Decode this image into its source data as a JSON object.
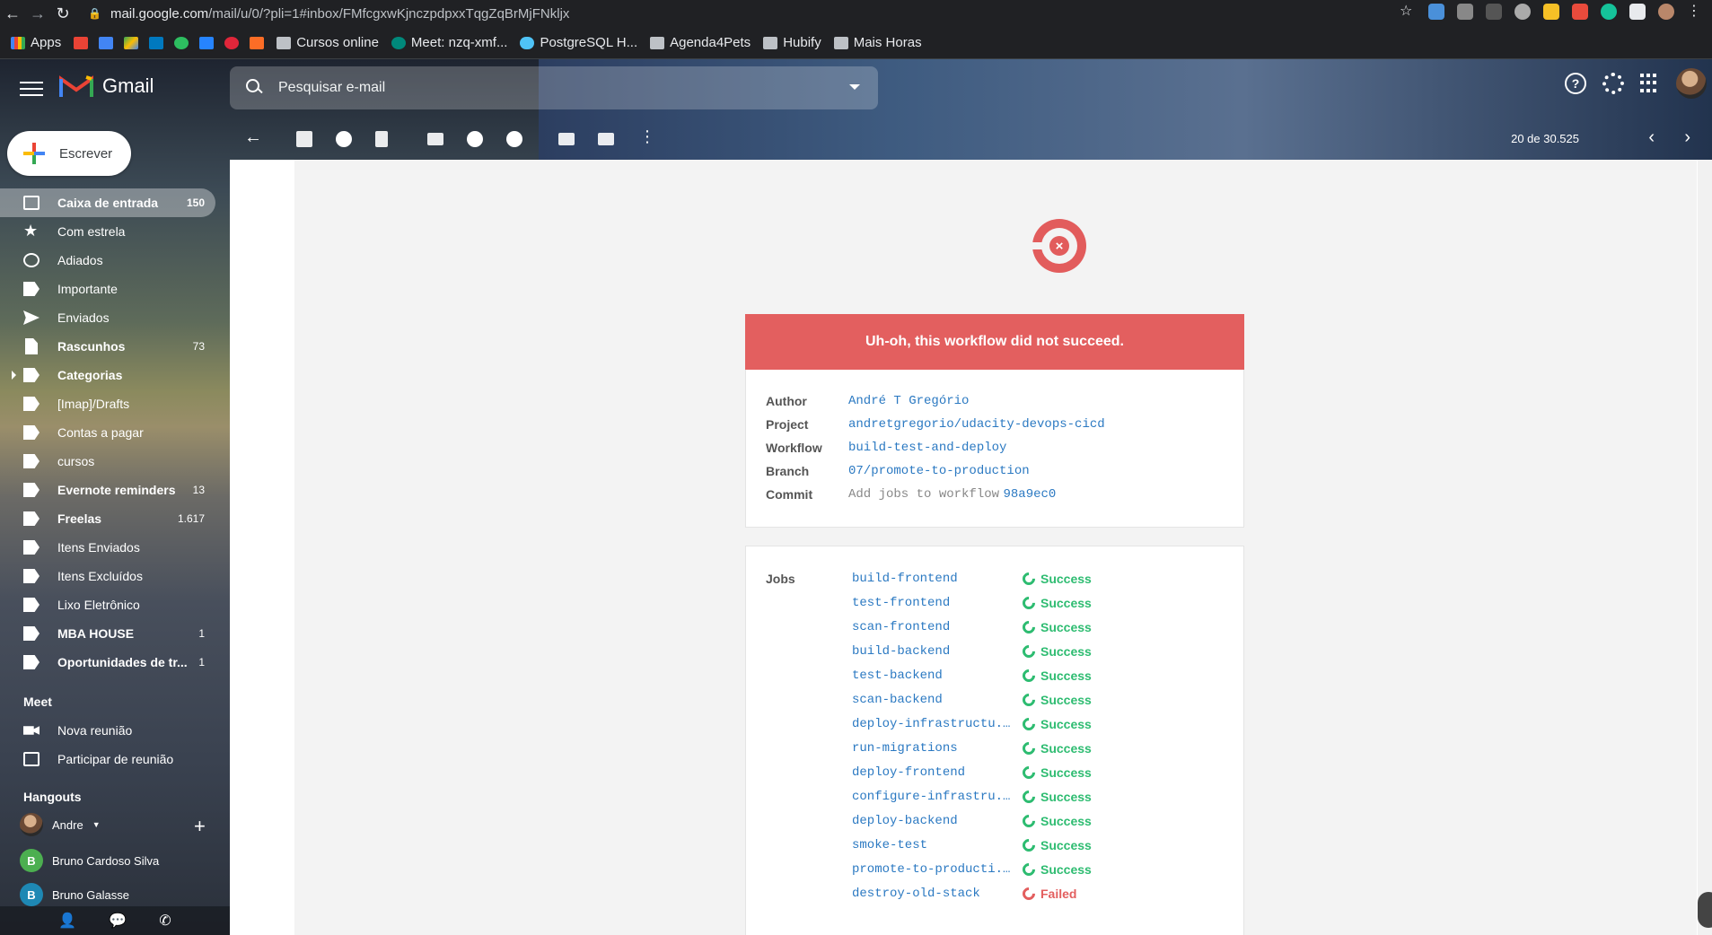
{
  "browser": {
    "url_host": "mail.google.com",
    "url_path": "/mail/u/0/?pli=1#inbox/FMfcgxwKjnczpdpxxTqgZqBrMjFNkljx",
    "bookmarks": [
      "Apps",
      "Cursos online",
      "Meet: nzq-xmf...",
      "PostgreSQL H...",
      "Agenda4Pets",
      "Hubify",
      "Mais Horas"
    ]
  },
  "header": {
    "app_name": "Gmail",
    "search_placeholder": "Pesquisar e-mail"
  },
  "sidebar": {
    "compose_label": "Escrever",
    "items": [
      {
        "label": "Caixa de entrada",
        "count": "150"
      },
      {
        "label": "Com estrela",
        "count": ""
      },
      {
        "label": "Adiados",
        "count": ""
      },
      {
        "label": "Importante",
        "count": ""
      },
      {
        "label": "Enviados",
        "count": ""
      },
      {
        "label": "Rascunhos",
        "count": "73"
      },
      {
        "label": "Categorias",
        "count": ""
      },
      {
        "label": "[Imap]/Drafts",
        "count": ""
      },
      {
        "label": "Contas a pagar",
        "count": ""
      },
      {
        "label": "cursos",
        "count": ""
      },
      {
        "label": "Evernote reminders",
        "count": "13"
      },
      {
        "label": "Freelas",
        "count": "1.617"
      },
      {
        "label": "Itens Enviados",
        "count": ""
      },
      {
        "label": "Itens Excluídos",
        "count": ""
      },
      {
        "label": "Lixo Eletrônico",
        "count": ""
      },
      {
        "label": "MBA HOUSE",
        "count": "1"
      },
      {
        "label": "Oportunidades de tr...",
        "count": "1"
      }
    ],
    "meet_title": "Meet",
    "meet_items": [
      "Nova reunião",
      "Participar de reunião"
    ],
    "hangouts_title": "Hangouts",
    "hangouts_user": "Andre",
    "contacts": [
      {
        "initial": "B",
        "name": "Bruno Cardoso Silva",
        "color": "#4caf50"
      },
      {
        "initial": "B",
        "name": "Bruno Galasse",
        "color": "#1e88b4"
      }
    ]
  },
  "toolbar": {
    "count_label": "20 de 30.525"
  },
  "email": {
    "banner": "Uh-oh, this workflow did not succeed.",
    "fields": [
      {
        "label": "Author",
        "value": "André T Gregório",
        "extra": ""
      },
      {
        "label": "Project",
        "value": "andretgregorio/udacity-devops-cicd",
        "extra": ""
      },
      {
        "label": "Workflow",
        "value": "build-test-and-deploy",
        "extra": ""
      },
      {
        "label": "Branch",
        "value": "07/promote-to-production",
        "extra": ""
      },
      {
        "label": "Commit",
        "value": "Add jobs to workflow",
        "extra": "98a9ec0"
      }
    ],
    "jobs_title": "Jobs",
    "jobs": [
      {
        "name": "build-frontend",
        "status": "Success"
      },
      {
        "name": "test-frontend",
        "status": "Success"
      },
      {
        "name": "scan-frontend",
        "status": "Success"
      },
      {
        "name": "build-backend",
        "status": "Success"
      },
      {
        "name": "test-backend",
        "status": "Success"
      },
      {
        "name": "scan-backend",
        "status": "Success"
      },
      {
        "name": "deploy-infrastructu...",
        "status": "Success"
      },
      {
        "name": "run-migrations",
        "status": "Success"
      },
      {
        "name": "deploy-frontend",
        "status": "Success"
      },
      {
        "name": "configure-infrastru...",
        "status": "Success"
      },
      {
        "name": "deploy-backend",
        "status": "Success"
      },
      {
        "name": "smoke-test",
        "status": "Success"
      },
      {
        "name": "promote-to-producti...",
        "status": "Success"
      },
      {
        "name": "destroy-old-stack",
        "status": "Failed"
      }
    ]
  }
}
